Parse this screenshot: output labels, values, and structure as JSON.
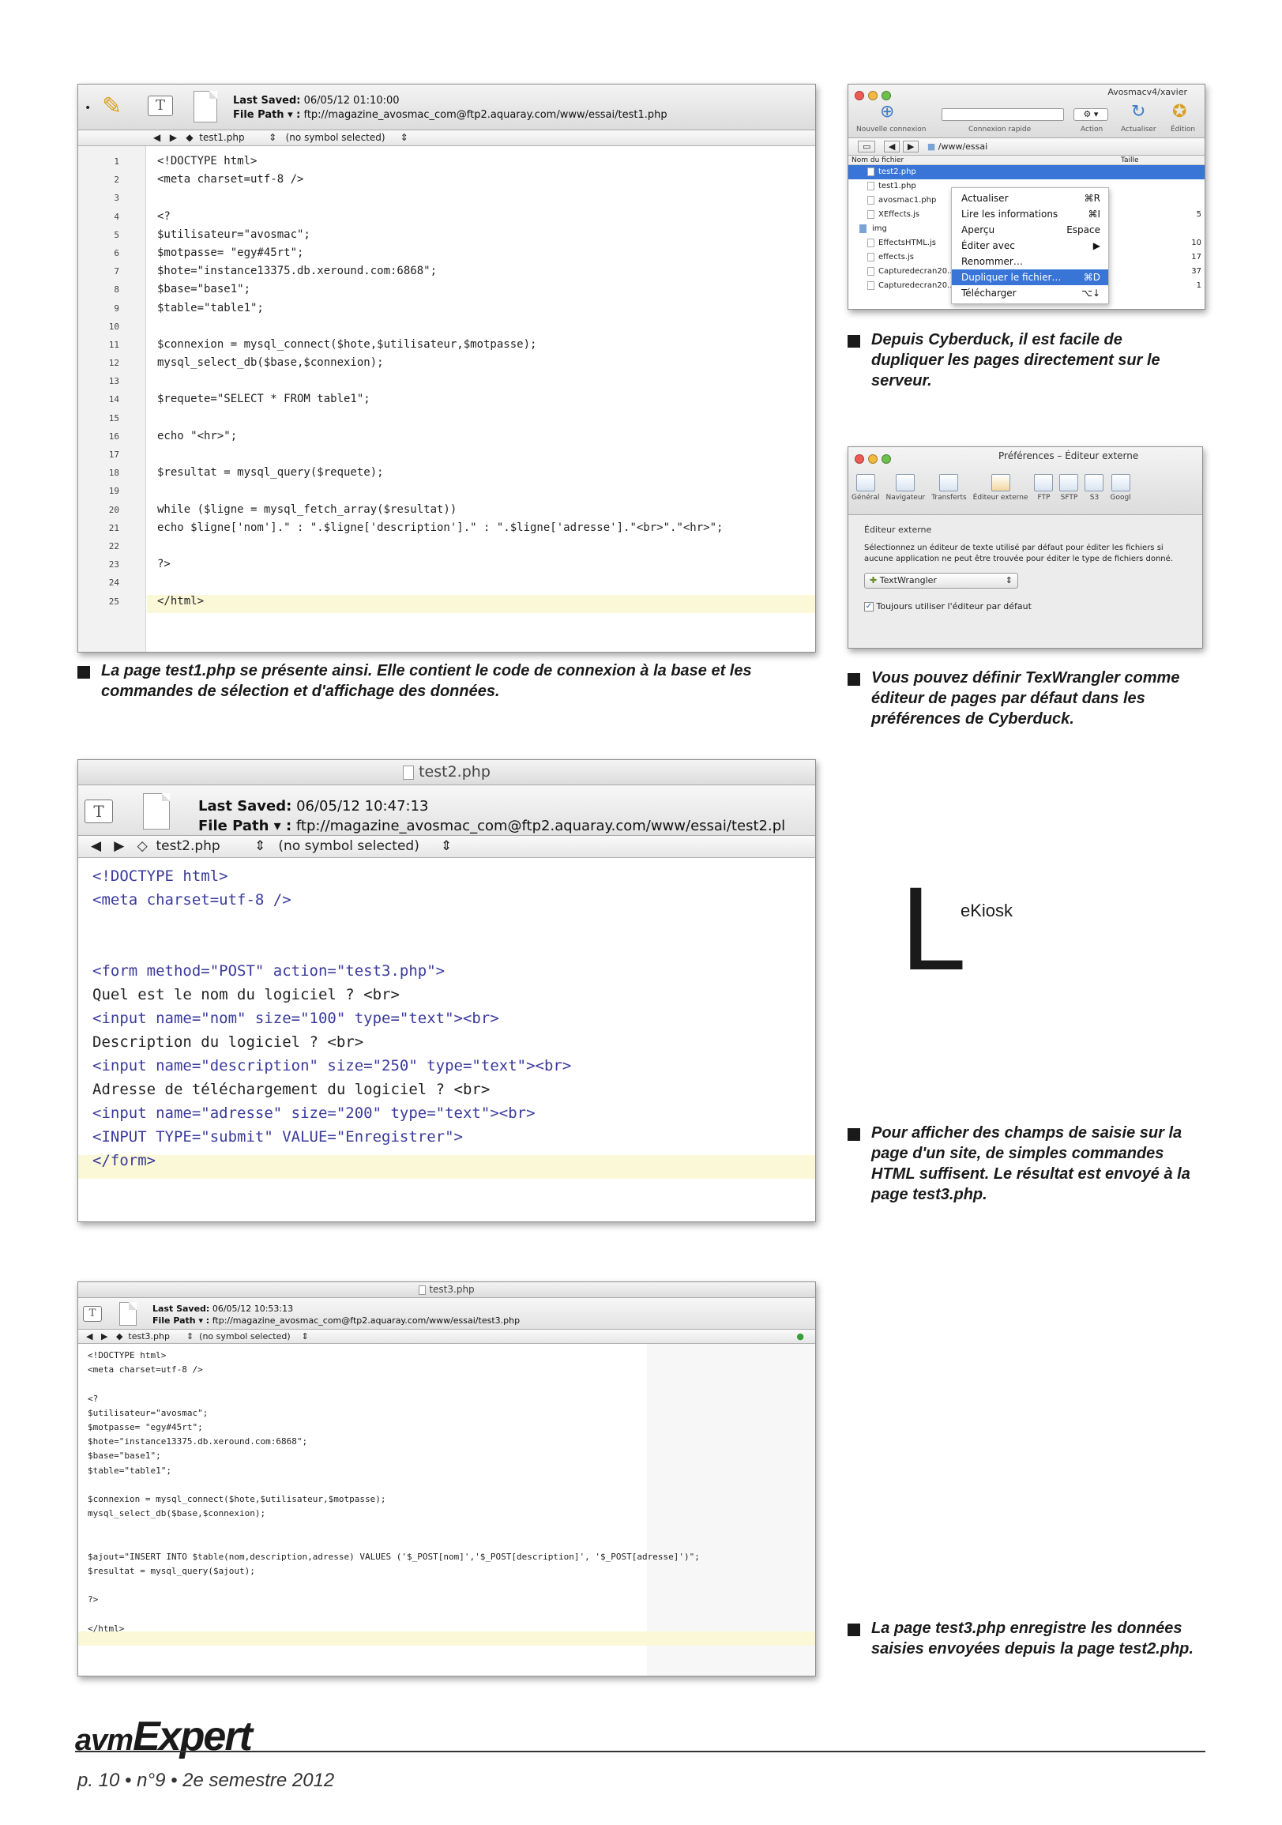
{
  "shot1": {
    "last_saved_label": "Last Saved:",
    "last_saved_value": "06/05/12 01:10:00",
    "file_path_label": "File Path ▾ :",
    "file_path_value": "ftp://magazine_avosmac_com@ftp2.aquaray.com/www/essai/test1.php",
    "nav_file": "test1.php",
    "nav_symbol": "(no symbol selected)",
    "lines": [
      {
        "n": "1",
        "t": "<!DOCTYPE html>"
      },
      {
        "n": "2",
        "t": "<meta charset=utf-8 />"
      },
      {
        "n": "3",
        "t": ""
      },
      {
        "n": "4",
        "t": "<?"
      },
      {
        "n": "5",
        "t": "$utilisateur=\"avosmac\";"
      },
      {
        "n": "6",
        "t": "$motpasse= \"egy#45rt\";"
      },
      {
        "n": "7",
        "t": "$hote=\"instance13375.db.xeround.com:6868\";"
      },
      {
        "n": "8",
        "t": "$base=\"base1\";"
      },
      {
        "n": "9",
        "t": "$table=\"table1\";"
      },
      {
        "n": "10",
        "t": ""
      },
      {
        "n": "11",
        "t": "$connexion = mysql_connect($hote,$utilisateur,$motpasse);"
      },
      {
        "n": "12",
        "t": "mysql_select_db($base,$connexion);"
      },
      {
        "n": "13",
        "t": ""
      },
      {
        "n": "14",
        "t": "$requete=\"SELECT * FROM table1\";"
      },
      {
        "n": "15",
        "t": ""
      },
      {
        "n": "16",
        "t": "echo \"<hr>\";"
      },
      {
        "n": "17",
        "t": ""
      },
      {
        "n": "18",
        "t": "$resultat = mysql_query($requete);"
      },
      {
        "n": "19",
        "t": ""
      },
      {
        "n": "20",
        "t": "while ($ligne = mysql_fetch_array($resultat))"
      },
      {
        "n": "21",
        "t": "echo $ligne['nom'].\" : \".$ligne['description'].\" : \".$ligne['adresse'].\"<br>\".\"<hr>\";"
      },
      {
        "n": "22",
        "t": ""
      },
      {
        "n": "23",
        "t": "?>"
      },
      {
        "n": "24",
        "t": ""
      },
      {
        "n": "25",
        "t": "</html>"
      }
    ]
  },
  "caption1": "La page test1.php se présente ainsi. Elle contient le code de connexion à la base et les commandes de sélection et d'affichage des données.",
  "cyberduck": {
    "window_title": "Avosmacv4/xavier",
    "toolbar_labels": [
      "Nouvelle connexion",
      "Connexion rapide",
      "Action",
      "Actualiser",
      "Édition"
    ],
    "path": "/www/essai",
    "col_name": "Nom du fichier",
    "col_size": "Taille",
    "files": [
      "test2.php",
      "test1.php",
      "avosmac1.php",
      "XEffects.js",
      "img",
      "EffectsHTML.js",
      "effects.js",
      "Capturedecran20...",
      "Capturedecran20..."
    ],
    "sizes": [
      "",
      "",
      "",
      "5",
      "",
      "10",
      "17",
      "37",
      "1"
    ],
    "menu": [
      {
        "label": "Actualiser",
        "shortcut": "⌘R"
      },
      {
        "label": "Lire les informations",
        "shortcut": "⌘I"
      },
      {
        "label": "Aperçu",
        "shortcut": "Espace"
      },
      {
        "label": "Éditer avec",
        "shortcut": "▶"
      },
      {
        "label": "Renommer…",
        "shortcut": ""
      },
      {
        "label": "Dupliquer le fichier…",
        "shortcut": "⌘D"
      },
      {
        "label": "Télécharger",
        "shortcut": "⌥↓"
      }
    ]
  },
  "caption2": "Depuis Cyberduck, il est facile de dupliquer les pages directement sur le serveur.",
  "prefs": {
    "window_title": "Préférences – Éditeur externe",
    "tabs": [
      "Général",
      "Navigateur",
      "Transferts",
      "Éditeur externe",
      "FTP",
      "SFTP",
      "S3",
      "Googl"
    ],
    "section_title": "Éditeur externe",
    "description": "Sélectionnez un éditeur de texte utilisé par défaut pour éditer les fichiers si aucune application ne peut être trouvée pour éditer le type de fichiers donné.",
    "editor": "TextWrangler",
    "checkbox_label": "Toujours utiliser l'éditeur par défaut"
  },
  "caption3": "Vous pouvez définir TexWrangler comme éditeur de pages par défaut dans les préférences de Cyberduck.",
  "shot2": {
    "title": "test2.php",
    "last_saved_label": "Last Saved:",
    "last_saved_value": "06/05/12 10:47:13",
    "file_path_label": "File Path ▾ :",
    "file_path_value": "ftp://magazine_avosmac_com@ftp2.aquaray.com/www/essai/test2.pl",
    "nav_file": "test2.php",
    "nav_symbol": "(no symbol selected)",
    "lines": [
      "<!DOCTYPE html>",
      "<meta charset=utf-8 />",
      "",
      "",
      "<form method=\"POST\" action=\"test3.php\">",
      "Quel est le nom du logiciel ? <br>",
      "<input name=\"nom\" size=\"100\" type=\"text\"><br>",
      "Description du logiciel ? <br>",
      "<input name=\"description\" size=\"250\" type=\"text\"><br>",
      "Adresse de téléchargement du logiciel ? <br>",
      "<input name=\"adresse\" size=\"200\" type=\"text\"><br>",
      "<INPUT TYPE=\"submit\" VALUE=\"Enregistrer\">",
      "</form>"
    ]
  },
  "ekiosk": {
    "big": "L",
    "small": "eKiosk"
  },
  "caption4": "Pour afficher des champs de saisie sur la page d'un site, de simples commandes HTML suffisent. Le résultat est envoyé à la page test3.php.",
  "shot3": {
    "title": "test3.php",
    "last_saved_label": "Last Saved:",
    "last_saved_value": "06/05/12 10:53:13",
    "file_path_label": "File Path ▾ :",
    "file_path_value": "ftp://magazine_avosmac_com@ftp2.aquaray.com/www/essai/test3.php",
    "nav_file": "test3.php",
    "nav_symbol": "(no symbol selected)",
    "lines": [
      "<!DOCTYPE html>",
      "<meta charset=utf-8 />",
      "",
      "<?",
      "$utilisateur=\"avosmac\";",
      "$motpasse= \"egy#45rt\";",
      "$hote=\"instance13375.db.xeround.com:6868\";",
      "$base=\"base1\";",
      "$table=\"table1\";",
      "",
      "$connexion = mysql_connect($hote,$utilisateur,$motpasse);",
      "mysql_select_db($base,$connexion);",
      "",
      "",
      "$ajout=\"INSERT INTO $table(nom,description,adresse) VALUES ('$_POST[nom]','$_POST[description]', '$_POST[adresse]')\";",
      "$resultat = mysql_query($ajout);",
      "",
      "?>",
      "",
      "</html>"
    ]
  },
  "caption5": "La page test3.php enregistre les données saisies envoyées depuis la page test2.php.",
  "footer": {
    "brand_prefix": "avm",
    "brand_main": "Expert",
    "folio": "p. 10 • n°9 • 2e semestre 2012"
  },
  "colors": {
    "keyword": "#3a3a9c",
    "string": "#c2185b",
    "func": "#6a3aa0",
    "caption_bullet": "#1a1a1a"
  }
}
